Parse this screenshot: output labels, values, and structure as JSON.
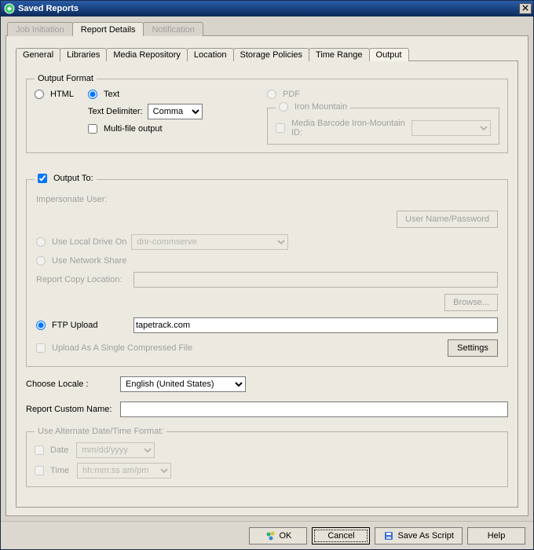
{
  "window": {
    "title": "Saved Reports"
  },
  "outer_tabs": [
    {
      "label": "Job Initiation",
      "enabled": false
    },
    {
      "label": "Report Details",
      "enabled": true,
      "active": true
    },
    {
      "label": "Notification",
      "enabled": false
    }
  ],
  "inner_tabs": [
    {
      "label": "General"
    },
    {
      "label": "Libraries"
    },
    {
      "label": "Media Repository"
    },
    {
      "label": "Location"
    },
    {
      "label": "Storage Policies"
    },
    {
      "label": "Time Range"
    },
    {
      "label": "Output",
      "active": true
    }
  ],
  "output_format": {
    "legend": "Output Format",
    "html_label": "HTML",
    "text_label": "Text",
    "text_selected": true,
    "delimiter_label": "Text Delimiter:",
    "delimiter_value": "Comma",
    "multifile_label": "Multi-file output",
    "multifile_checked": false,
    "pdf_label": "PDF",
    "iron_group": "Iron Mountain",
    "media_barcode_label": "Media Barcode   Iron-Mountain ID:"
  },
  "output_to": {
    "legend": "Output To:",
    "checked": true,
    "impersonate_label": "Impersonate User:",
    "username_btn": "User Name/Password",
    "local_drive_label": "Use Local Drive On",
    "local_drive_host": "dnr-commserve",
    "network_share_label": "Use Network Share",
    "report_copy_label": "Report Copy Location:",
    "browse_btn": "Browse...",
    "ftp_label": "FTP Upload",
    "ftp_value": "tapetrack.com",
    "ftp_selected": true,
    "compressed_label": "Upload As A Single Compressed File",
    "settings_btn": "Settings"
  },
  "locale": {
    "label": "Choose Locale :",
    "value": "English (United States)"
  },
  "custom_name": {
    "label": "Report Custom Name:",
    "value": ""
  },
  "dt_format": {
    "legend": "Use Alternate Date/Time Format:",
    "date_label": "Date",
    "date_placeholder": "mm/dd/yyyy",
    "time_label": "Time",
    "time_placeholder": "hh:mm:ss am/pm"
  },
  "buttons": {
    "ok": "OK",
    "cancel": "Cancel",
    "save_as_script": "Save As Script",
    "help": "Help"
  }
}
